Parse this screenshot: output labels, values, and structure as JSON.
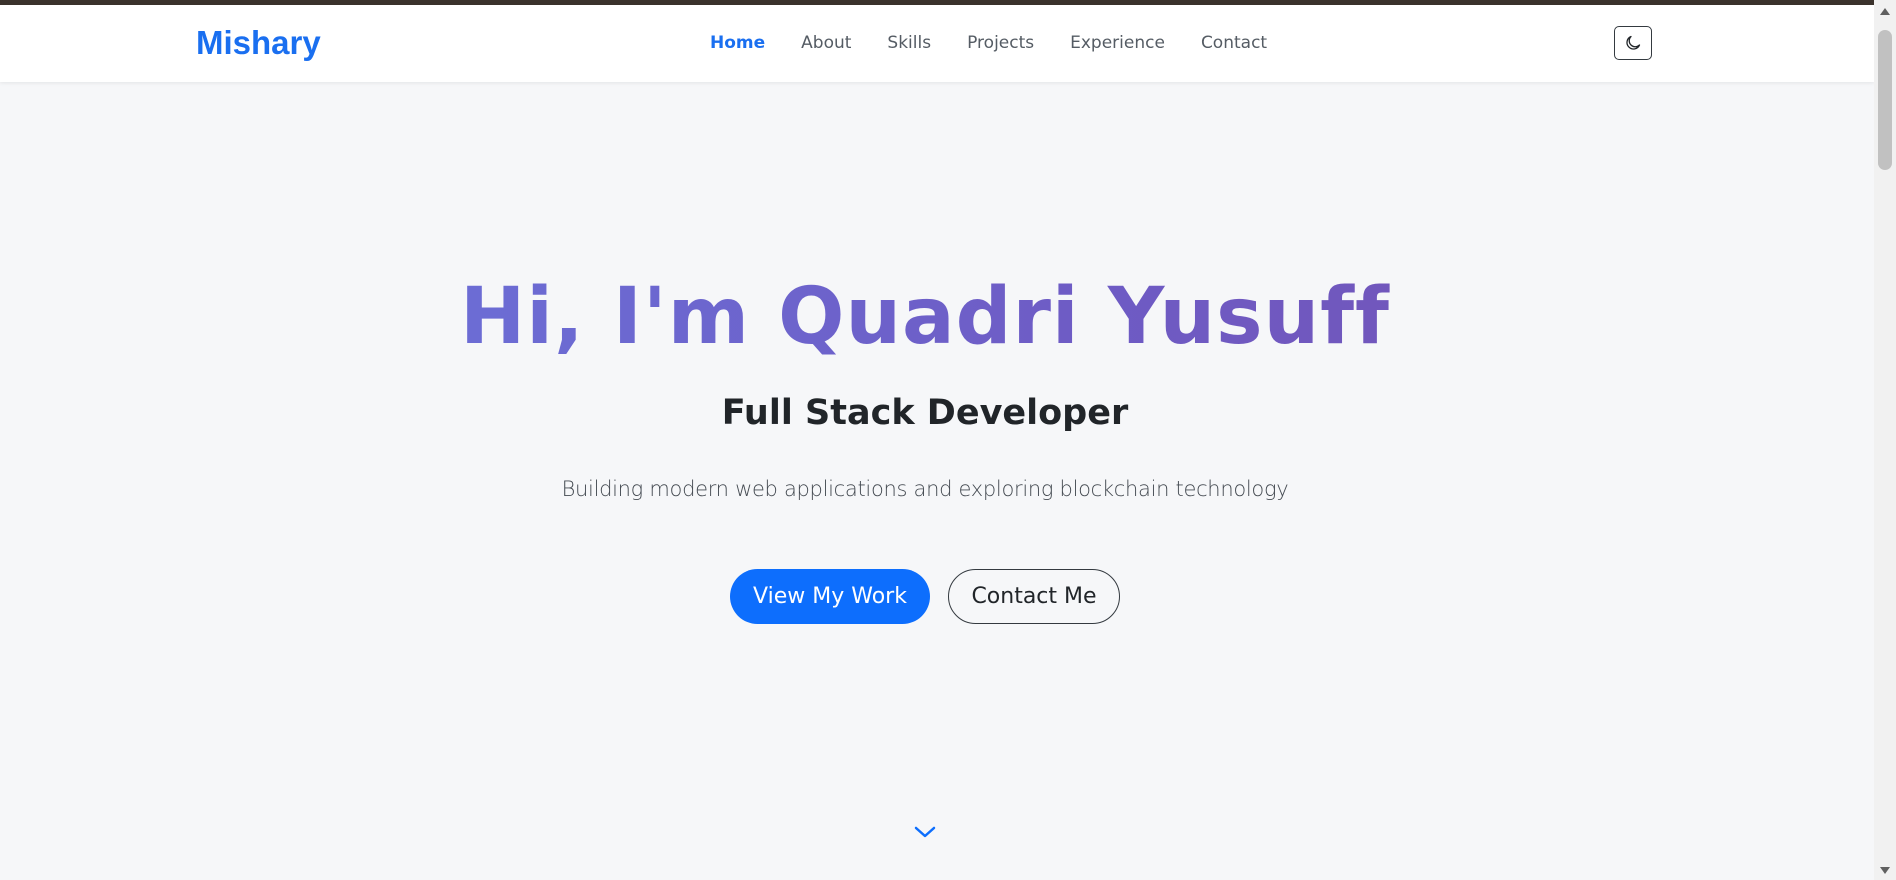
{
  "brand": "Mishary",
  "nav": {
    "items": [
      {
        "label": "Home",
        "active": true
      },
      {
        "label": "About",
        "active": false
      },
      {
        "label": "Skills",
        "active": false
      },
      {
        "label": "Projects",
        "active": false
      },
      {
        "label": "Experience",
        "active": false
      },
      {
        "label": "Contact",
        "active": false
      }
    ],
    "theme_toggle_icon": "moon-icon"
  },
  "hero": {
    "title": "Hi, I'm Quadri Yusuff",
    "subtitle": "Full Stack Developer",
    "description": "Building modern web applications and exploring blockchain technology",
    "primary_button": "View My Work",
    "secondary_button": "Contact Me",
    "scroll_icon": "chevron-down-icon"
  },
  "colors": {
    "accent": "#0d6efd",
    "brand": "#1a6ff0",
    "title_gradient_start": "#6a79e0",
    "title_gradient_end": "#7650b0",
    "background": "#f6f7f9"
  }
}
